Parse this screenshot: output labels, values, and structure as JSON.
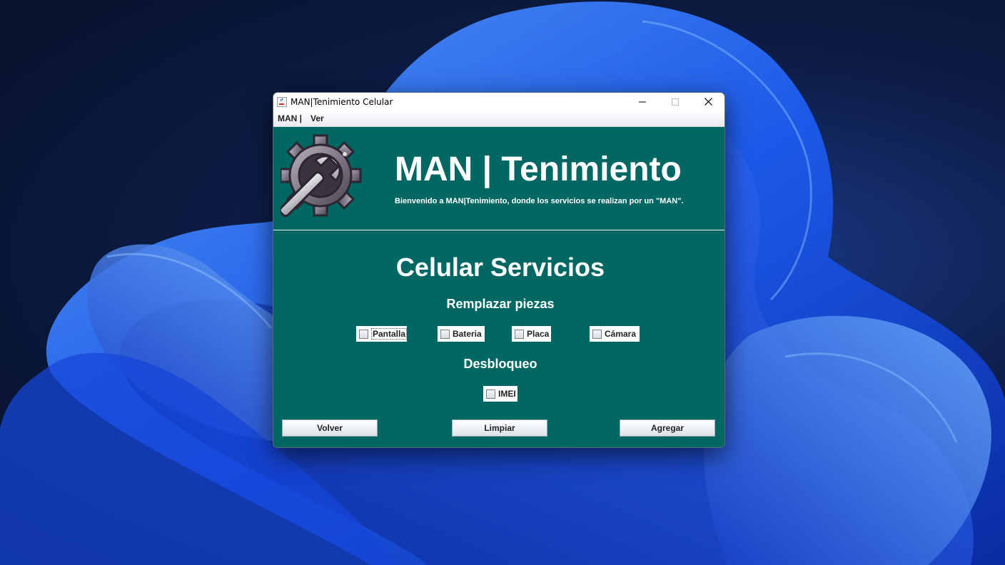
{
  "window": {
    "title": "MAN|Tenimiento Celular"
  },
  "menu": {
    "items": [
      "MAN |",
      "Ver"
    ]
  },
  "header": {
    "title": "MAN | Tenimiento",
    "subtitle": "Bienvenido a MAN|Tenimiento, donde los servicios se realizan por un \"MAN\".",
    "logo_icon": "gear-wrench-icon"
  },
  "main": {
    "section_title": "Celular Servicios",
    "replace_heading": "Remplazar piezas",
    "replace_options": [
      {
        "label": "Pantalla",
        "checked": false
      },
      {
        "label": "Bateria",
        "checked": false
      },
      {
        "label": "Placa",
        "checked": false
      },
      {
        "label": "Cámara",
        "checked": false
      }
    ],
    "unlock_heading": "Desbloqueo",
    "unlock_options": [
      {
        "label": "IMEI",
        "checked": false
      }
    ]
  },
  "buttons": {
    "back": "Volver",
    "clear": "Limpiar",
    "add": "Agregar"
  },
  "colors": {
    "panel_background": "#006763",
    "text": "#ffffff"
  }
}
